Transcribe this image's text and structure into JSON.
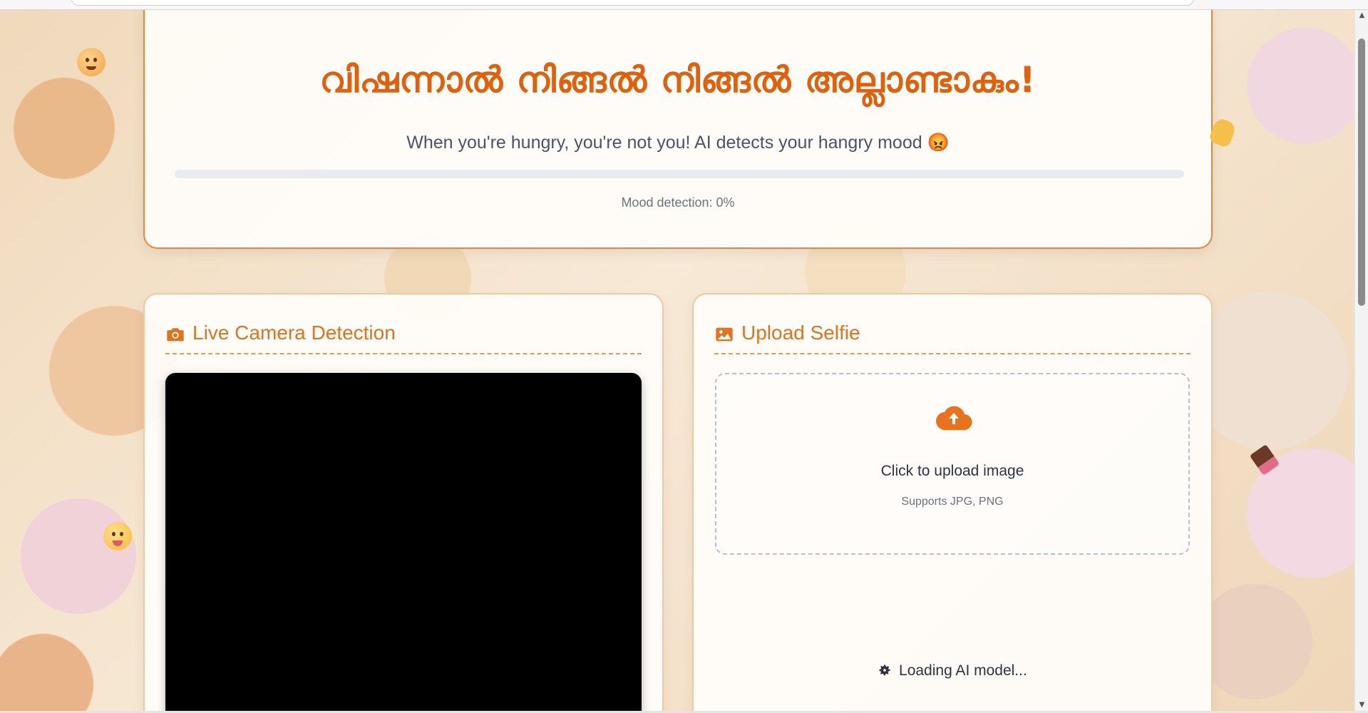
{
  "header": {
    "title": "വിഷന്നാൽ നിങ്ങൽ നിങ്ങൽ അല്ലാണ്ടാകും!",
    "subtitle": "When you're hungry, you're not you! AI detects your hangry mood 😡",
    "progress": {
      "label": "Mood detection: 0%",
      "value": 0
    }
  },
  "camera_panel": {
    "title": "Live Camera Detection",
    "icon": "camera-icon"
  },
  "upload_panel": {
    "title": "Upload Selfie",
    "icon": "image-icon",
    "dropzone": {
      "icon": "cloud-upload-icon",
      "main_text": "Click to upload image",
      "sub_text": "Supports JPG, PNG"
    },
    "status": {
      "icon": "gear-icon",
      "text": "Loading AI model..."
    }
  },
  "colors": {
    "accent": "#e0731d",
    "title": "#e0600b",
    "text": "#4a5468"
  }
}
